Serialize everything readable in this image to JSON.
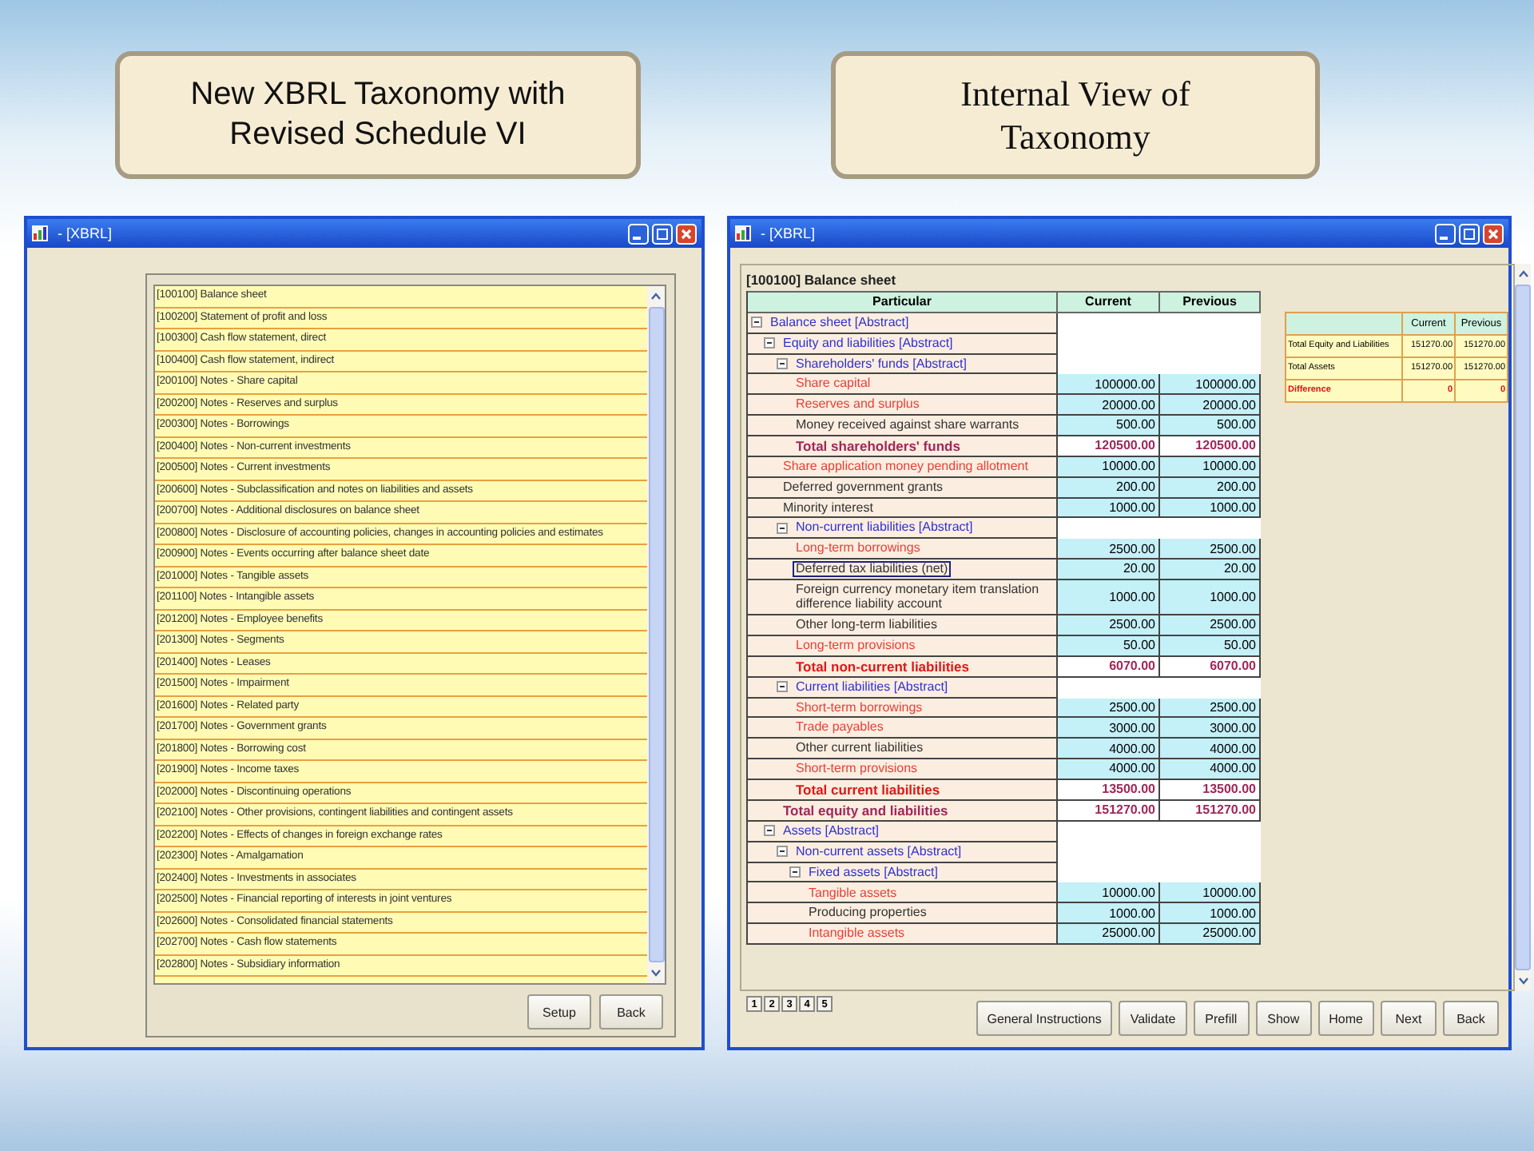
{
  "callouts": [
    {
      "kind": "sans",
      "lines": [
        "New XBRL Taxonomy with",
        "Revised Schedule VI"
      ]
    },
    {
      "kind": "serif",
      "lines": [
        "Internal View of",
        "Taxonomy"
      ]
    }
  ],
  "left_window": {
    "title": "- [XBRL]",
    "list": [
      "[100100] Balance sheet",
      "[100200] Statement of profit and loss",
      "[100300] Cash flow statement, direct",
      "[100400] Cash flow statement, indirect",
      "[200100] Notes - Share capital",
      "[200200] Notes - Reserves and surplus",
      "[200300] Notes - Borrowings",
      "[200400] Notes - Non-current investments",
      "[200500] Notes - Current investments",
      "[200600] Notes - Subclassification and notes on liabilities and assets",
      "[200700] Notes - Additional disclosures on balance sheet",
      "[200800] Notes - Disclosure of accounting policies, changes in accounting policies and estimates",
      "[200900] Notes - Events occurring after balance sheet date",
      "[201000] Notes - Tangible assets",
      "[201100] Notes - Intangible assets",
      "[201200] Notes - Employee benefits",
      "[201300] Notes - Segments",
      "[201400] Notes - Leases",
      "[201500] Notes - Impairment",
      "[201600] Notes - Related party",
      "[201700] Notes - Government grants",
      "[201800] Notes - Borrowing cost",
      "[201900] Notes - Income taxes",
      "[202000] Notes - Discontinuing operations",
      "[202100] Notes - Other provisions, contingent liabilities and contingent assets",
      "[202200] Notes - Effects of changes in foreign exchange rates",
      "[202300] Notes - Amalgamation",
      "[202400] Notes - Investments in associates",
      "[202500] Notes - Financial reporting of interests in joint ventures",
      "[202600] Notes - Consolidated financial statements",
      "[202700] Notes - Cash flow statements",
      "[202800] Notes - Subsidiary information"
    ],
    "buttons": [
      "Setup",
      "Back"
    ]
  },
  "right_window": {
    "title": "- [XBRL]",
    "sheet_title": "[100100] Balance sheet",
    "columns": [
      "Particular",
      "Current",
      "Previous"
    ],
    "tree": [
      {
        "kind": "abstract",
        "label": "Balance sheet [Abstract]",
        "expanded": true,
        "children": [
          {
            "kind": "abstract",
            "label": "Equity and liabilities [Abstract]",
            "expanded": true,
            "children": [
              {
                "kind": "abstract",
                "label": "Shareholders' funds [Abstract]",
                "expanded": true,
                "children": [
                  {
                    "kind": "item",
                    "label": "Share capital",
                    "color": "#e8403a",
                    "current": "100000.00",
                    "previous": "100000.00",
                    "selected": false
                  },
                  {
                    "kind": "item",
                    "label": "Reserves and surplus",
                    "color": "#e8403a",
                    "current": "20000.00",
                    "previous": "20000.00",
                    "selected": false
                  },
                  {
                    "kind": "item",
                    "label": "Money received against share warrants",
                    "color": "#333333",
                    "current": "500.00",
                    "previous": "500.00",
                    "selected": false
                  },
                  {
                    "kind": "total",
                    "label": "Total shareholders' funds",
                    "color": "#a0285a",
                    "current": "120500.00",
                    "previous": "120500.00",
                    "selected": false
                  }
                ]
              },
              {
                "kind": "item",
                "label": "Share application money pending allotment",
                "color": "#e8403a",
                "current": "10000.00",
                "previous": "10000.00",
                "selected": false
              },
              {
                "kind": "item",
                "label": "Deferred government grants",
                "color": "#333333",
                "current": "200.00",
                "previous": "200.00",
                "selected": false
              },
              {
                "kind": "item",
                "label": "Minority interest",
                "color": "#333333",
                "current": "1000.00",
                "previous": "1000.00",
                "selected": false
              },
              {
                "kind": "abstract",
                "label": "Non-current liabilities [Abstract]",
                "expanded": true,
                "children": [
                  {
                    "kind": "item",
                    "label": "Long-term borrowings",
                    "color": "#e8403a",
                    "current": "2500.00",
                    "previous": "2500.00",
                    "selected": false
                  },
                  {
                    "kind": "item",
                    "label": "Deferred tax liabilities (net)",
                    "color": "#333333",
                    "current": "20.00",
                    "previous": "20.00",
                    "selected": true
                  },
                  {
                    "kind": "item",
                    "label": "Foreign currency monetary item translation difference liability account",
                    "color": "#333333",
                    "current": "1000.00",
                    "previous": "1000.00",
                    "selected": false
                  },
                  {
                    "kind": "item",
                    "label": "Other long-term liabilities",
                    "color": "#333333",
                    "current": "2500.00",
                    "previous": "2500.00",
                    "selected": false
                  },
                  {
                    "kind": "item",
                    "label": "Long-term provisions",
                    "color": "#e8403a",
                    "current": "50.00",
                    "previous": "50.00",
                    "selected": false
                  },
                  {
                    "kind": "total",
                    "label": "Total non-current liabilities",
                    "color": "#e01818",
                    "current": "6070.00",
                    "previous": "6070.00",
                    "selected": false
                  }
                ]
              },
              {
                "kind": "abstract",
                "label": "Current liabilities [Abstract]",
                "expanded": true,
                "children": [
                  {
                    "kind": "item",
                    "label": "Short-term borrowings",
                    "color": "#e8403a",
                    "current": "2500.00",
                    "previous": "2500.00",
                    "selected": false
                  },
                  {
                    "kind": "item",
                    "label": "Trade payables",
                    "color": "#e8403a",
                    "current": "3000.00",
                    "previous": "3000.00",
                    "selected": false
                  },
                  {
                    "kind": "item",
                    "label": "Other current liabilities",
                    "color": "#333333",
                    "current": "4000.00",
                    "previous": "4000.00",
                    "selected": false
                  },
                  {
                    "kind": "item",
                    "label": "Short-term provisions",
                    "color": "#e8403a",
                    "current": "4000.00",
                    "previous": "4000.00",
                    "selected": false
                  },
                  {
                    "kind": "total",
                    "label": "Total current liabilities",
                    "color": "#e01818",
                    "current": "13500.00",
                    "previous": "13500.00",
                    "selected": false
                  }
                ]
              },
              {
                "kind": "total",
                "label": "Total equity and liabilities",
                "color": "#a0285a",
                "current": "151270.00",
                "previous": "151270.00",
                "selected": false
              }
            ]
          },
          {
            "kind": "abstract",
            "label": "Assets [Abstract]",
            "expanded": true,
            "children": [
              {
                "kind": "abstract",
                "label": "Non-current assets [Abstract]",
                "expanded": true,
                "children": [
                  {
                    "kind": "abstract",
                    "label": "Fixed assets [Abstract]",
                    "expanded": true,
                    "children": [
                      {
                        "kind": "item",
                        "label": "Tangible assets",
                        "color": "#e8403a",
                        "current": "10000.00",
                        "previous": "10000.00",
                        "selected": false
                      },
                      {
                        "kind": "item",
                        "label": "Producing properties",
                        "color": "#333333",
                        "current": "1000.00",
                        "previous": "1000.00",
                        "selected": false
                      },
                      {
                        "kind": "item",
                        "label": "Intangible assets",
                        "color": "#e8403a",
                        "current": "25000.00",
                        "previous": "25000.00",
                        "selected": false
                      }
                    ]
                  }
                ]
              }
            ]
          }
        ]
      }
    ],
    "summary": {
      "columns": [
        "Current",
        "Previous"
      ],
      "rows": [
        {
          "kind": "normal",
          "label": "Total Equity and Liabilities",
          "current": "151270.00",
          "previous": "151270.00"
        },
        {
          "kind": "normal",
          "label": "Total Assets",
          "current": "151270.00",
          "previous": "151270.00"
        },
        {
          "kind": "difference",
          "label": "Difference",
          "current": "0",
          "previous": "0"
        }
      ]
    },
    "pages": [
      "1",
      "2",
      "3",
      "4",
      "5"
    ],
    "buttons": [
      "General Instructions",
      "Validate",
      "Prefill",
      "Show",
      "Home",
      "Next",
      "Back"
    ]
  }
}
